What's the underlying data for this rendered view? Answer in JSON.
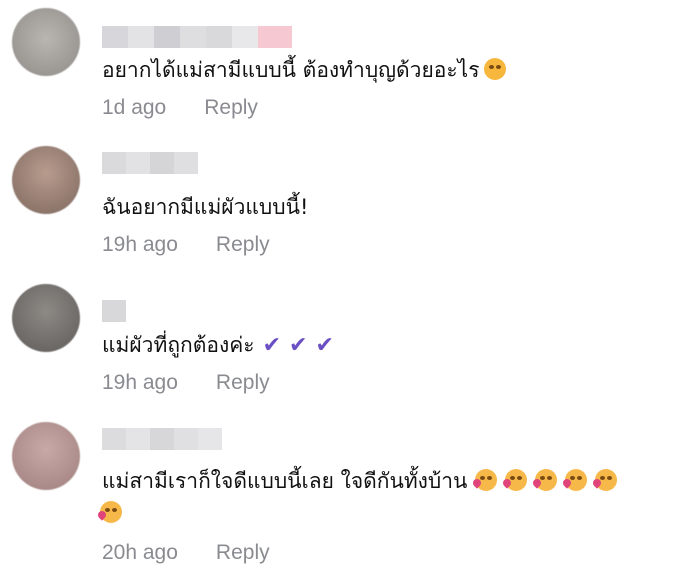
{
  "comments": [
    {
      "text": "อยากได้แม่สามีแบบนี้ ต้องทำบุญด้วยอะไร",
      "emoji": [
        "pleading-face"
      ],
      "time": "1d ago",
      "reply": "Reply"
    },
    {
      "text": "ฉันอยากมีแม่ผัวแบบนี้!",
      "emoji": [],
      "time": "19h ago",
      "reply": "Reply"
    },
    {
      "text": "แม่ผัวที่ถูกต้องค่ะ",
      "emoji": [
        "heavy-check-mark",
        "heavy-check-mark",
        "heavy-check-mark"
      ],
      "time": "19h ago",
      "reply": "Reply"
    },
    {
      "text": "แม่สามีเราก็ใจดีแบบนี้เลย ใจดีกันทั้งบ้าน",
      "emoji": [
        "smiling-face-with-hearts",
        "smiling-face-with-hearts",
        "smiling-face-with-hearts",
        "smiling-face-with-hearts",
        "smiling-face-with-hearts",
        "smiling-face-with-hearts"
      ],
      "time": "20h ago",
      "reply": "Reply"
    }
  ]
}
